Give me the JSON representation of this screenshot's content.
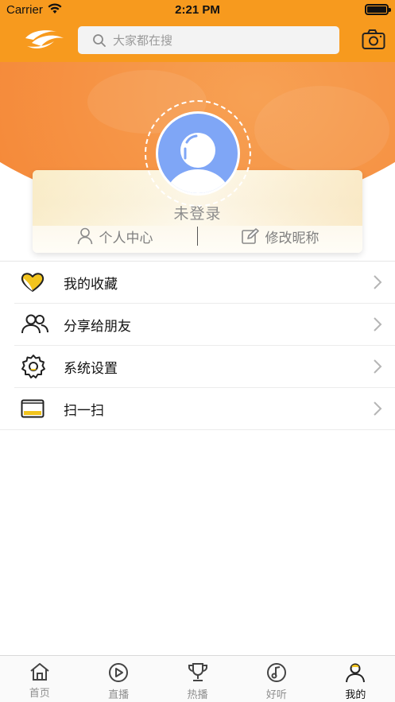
{
  "status_bar": {
    "carrier": "Carrier",
    "time": "2:21 PM"
  },
  "header": {
    "search_placeholder": "大家都在搜",
    "accent_color": "#f79a1e"
  },
  "profile": {
    "login_status": "未登录",
    "actions": [
      {
        "label": "个人中心",
        "icon": "user-icon"
      },
      {
        "label": "修改昵称",
        "icon": "edit-icon"
      }
    ]
  },
  "menu": {
    "items": [
      {
        "label": "我的收藏",
        "icon": "heart-icon"
      },
      {
        "label": "分享给朋友",
        "icon": "friends-icon"
      },
      {
        "label": "系统设置",
        "icon": "gear-icon"
      },
      {
        "label": "扫一扫",
        "icon": "scan-icon"
      }
    ]
  },
  "tabbar": {
    "tabs": [
      {
        "label": "首页",
        "icon": "home-icon",
        "active": false
      },
      {
        "label": "直播",
        "icon": "play-icon",
        "active": false
      },
      {
        "label": "热播",
        "icon": "trophy-icon",
        "active": false
      },
      {
        "label": "好听",
        "icon": "music-icon",
        "active": false
      },
      {
        "label": "我的",
        "icon": "profile-icon",
        "active": true
      }
    ]
  }
}
